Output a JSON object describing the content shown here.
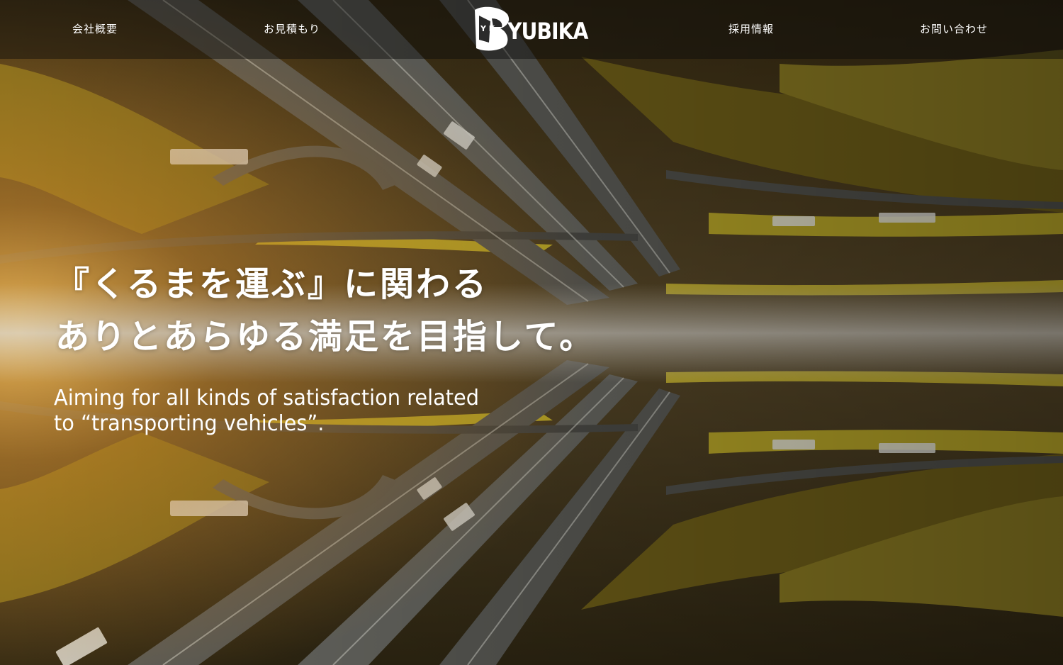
{
  "nav": {
    "items": [
      {
        "label": "会社概要"
      },
      {
        "label": "お見積もり"
      },
      {
        "label": "採用情報"
      },
      {
        "label": "お問い合わせ"
      }
    ]
  },
  "logo": {
    "text": "YUBIKA",
    "emblem_letters": "Y K"
  },
  "hero": {
    "headline_line1": "『くるまを運ぶ』に関わる",
    "headline_line2": "ありとあらゆる満足を目指して。",
    "subline_line1": "Aiming for all kinds of satisfaction related",
    "subline_line2": "to “transporting vehicles”."
  },
  "colors": {
    "text": "#ffffff",
    "nav_bar": "#0a0a0a",
    "grass": "#8a8a1a",
    "sun_glow": "#f0b040",
    "road": "#6a6a6a"
  }
}
